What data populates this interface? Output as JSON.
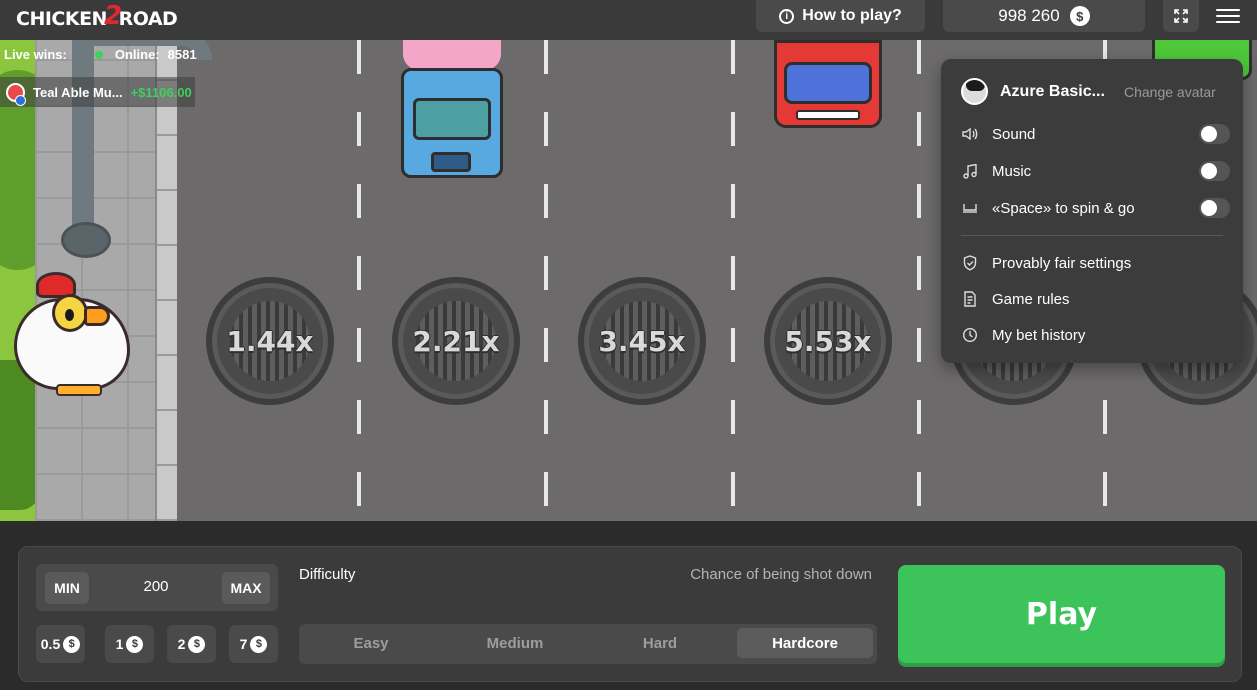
{
  "header": {
    "logo_text_a": "CHICKEN",
    "logo_text_b": "2",
    "logo_text_c": "ROAD",
    "how_to_play": "How to play?",
    "balance": "998 260",
    "currency_symbol": "$"
  },
  "live": {
    "live_wins_label": "Live wins:",
    "online_label": "Online:",
    "online_count": "8581",
    "win_user": "Teal Able Mu...",
    "win_amount": "+$1106.00"
  },
  "multipliers": [
    "1.44x",
    "2.21x",
    "3.45x",
    "5.53x"
  ],
  "menu": {
    "username": "Azure Basic...",
    "change_avatar": "Change avatar",
    "sound": "Sound",
    "music": "Music",
    "space": "«Space» to spin & go",
    "provably_fair": "Provably fair settings",
    "game_rules": "Game rules",
    "bet_history": "My bet history",
    "sound_on": false,
    "music_on": false,
    "space_on": false
  },
  "bet": {
    "min_label": "MIN",
    "max_label": "MAX",
    "amount": "200",
    "chips": [
      "0.5",
      "1",
      "2",
      "7"
    ]
  },
  "difficulty": {
    "label": "Difficulty",
    "chance_label": "Chance of being shot down",
    "options": [
      "Easy",
      "Medium",
      "Hard",
      "Hardcore"
    ],
    "selected": "Hardcore"
  },
  "play_label": "Play",
  "colors": {
    "accent_green": "#3cc35a",
    "win_green": "#3fcf5e",
    "panel_bg": "#3b3b3b"
  }
}
